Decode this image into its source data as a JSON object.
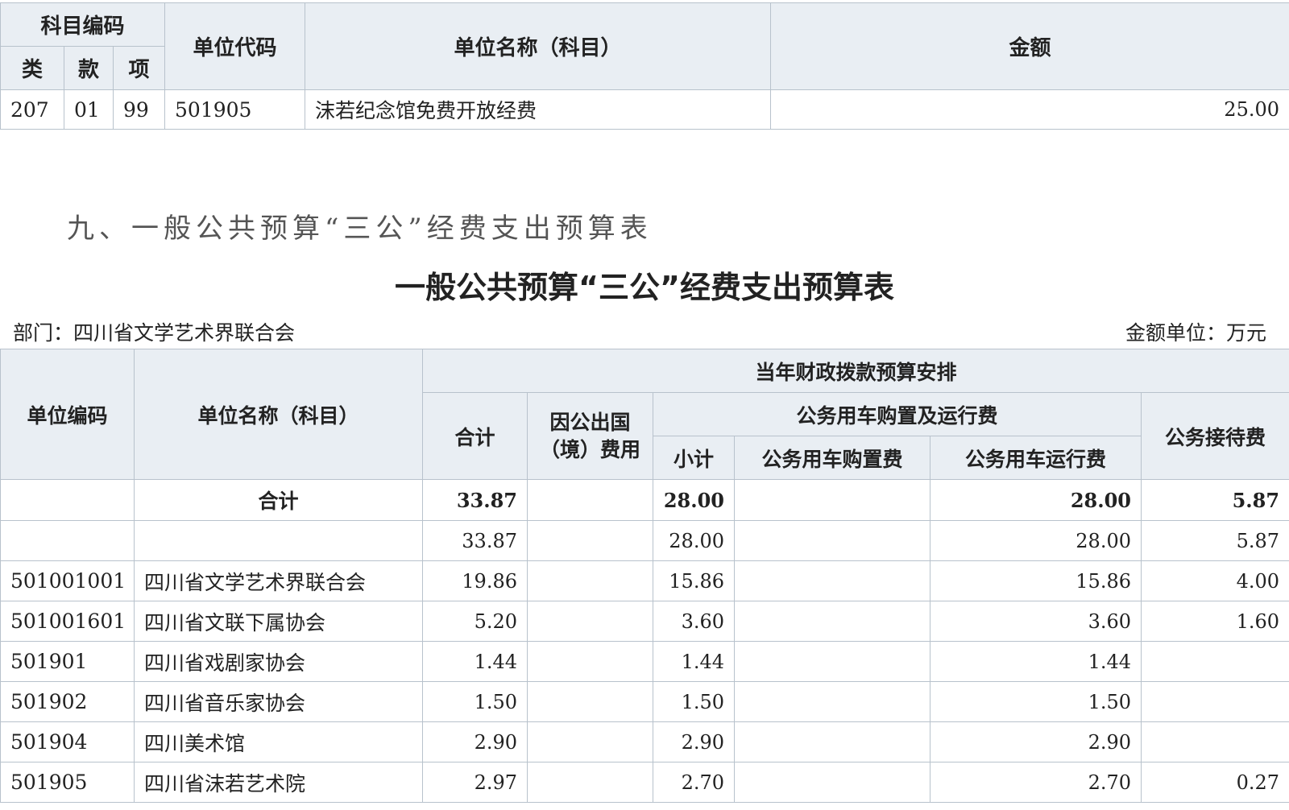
{
  "top_table": {
    "headers": {
      "code_group": "科目编码",
      "lei": "类",
      "kuan": "款",
      "xiang": "项",
      "unit_code": "单位代码",
      "unit_name": "单位名称（科目）",
      "amount": "金额"
    },
    "rows": [
      {
        "lei": "207",
        "kuan": "01",
        "xiang": "99",
        "unit_code": "501905",
        "unit_name": "沫若纪念馆免费开放经费",
        "amount": "25.00"
      }
    ]
  },
  "section_heading": "九、一般公共预算“三公”经费支出预算表",
  "table_title": "一般公共预算“三公”经费支出预算表",
  "department_label": "部门：四川省文学艺术界联合会",
  "unit_label": "金额单位：万元",
  "main_table": {
    "headers": {
      "unit_code": "单位编码",
      "unit_name": "单位名称（科目）",
      "fiscal_group": "当年财政拨款预算安排",
      "total": "合计",
      "abroad": "因公出国（境）费用",
      "vehicle_group": "公务用车购置及运行费",
      "subtotal": "小计",
      "vehicle_purchase": "公务用车购置费",
      "vehicle_operation": "公务用车运行费",
      "reception": "公务接待费"
    },
    "total_row": {
      "code": "",
      "name": "合计",
      "total": "33.87",
      "abroad": "",
      "subtotal": "28.00",
      "purchase": "",
      "operation": "28.00",
      "reception": "5.87"
    },
    "rows": [
      {
        "code": "",
        "name": "",
        "total": "33.87",
        "abroad": "",
        "subtotal": "28.00",
        "purchase": "",
        "operation": "28.00",
        "reception": "5.87"
      },
      {
        "code": "501001001",
        "name": "四川省文学艺术界联合会",
        "total": "19.86",
        "abroad": "",
        "subtotal": "15.86",
        "purchase": "",
        "operation": "15.86",
        "reception": "4.00"
      },
      {
        "code": "501001601",
        "name": "四川省文联下属协会",
        "total": "5.20",
        "abroad": "",
        "subtotal": "3.60",
        "purchase": "",
        "operation": "3.60",
        "reception": "1.60"
      },
      {
        "code": "501901",
        "name": "四川省戏剧家协会",
        "total": "1.44",
        "abroad": "",
        "subtotal": "1.44",
        "purchase": "",
        "operation": "1.44",
        "reception": ""
      },
      {
        "code": "501902",
        "name": "四川省音乐家协会",
        "total": "1.50",
        "abroad": "",
        "subtotal": "1.50",
        "purchase": "",
        "operation": "1.50",
        "reception": ""
      },
      {
        "code": "501904",
        "name": "四川美术馆",
        "total": "2.90",
        "abroad": "",
        "subtotal": "2.90",
        "purchase": "",
        "operation": "2.90",
        "reception": ""
      },
      {
        "code": "501905",
        "name": "四川省沫若艺术院",
        "total": "2.97",
        "abroad": "",
        "subtotal": "2.70",
        "purchase": "",
        "operation": "2.70",
        "reception": "0.27"
      }
    ]
  }
}
